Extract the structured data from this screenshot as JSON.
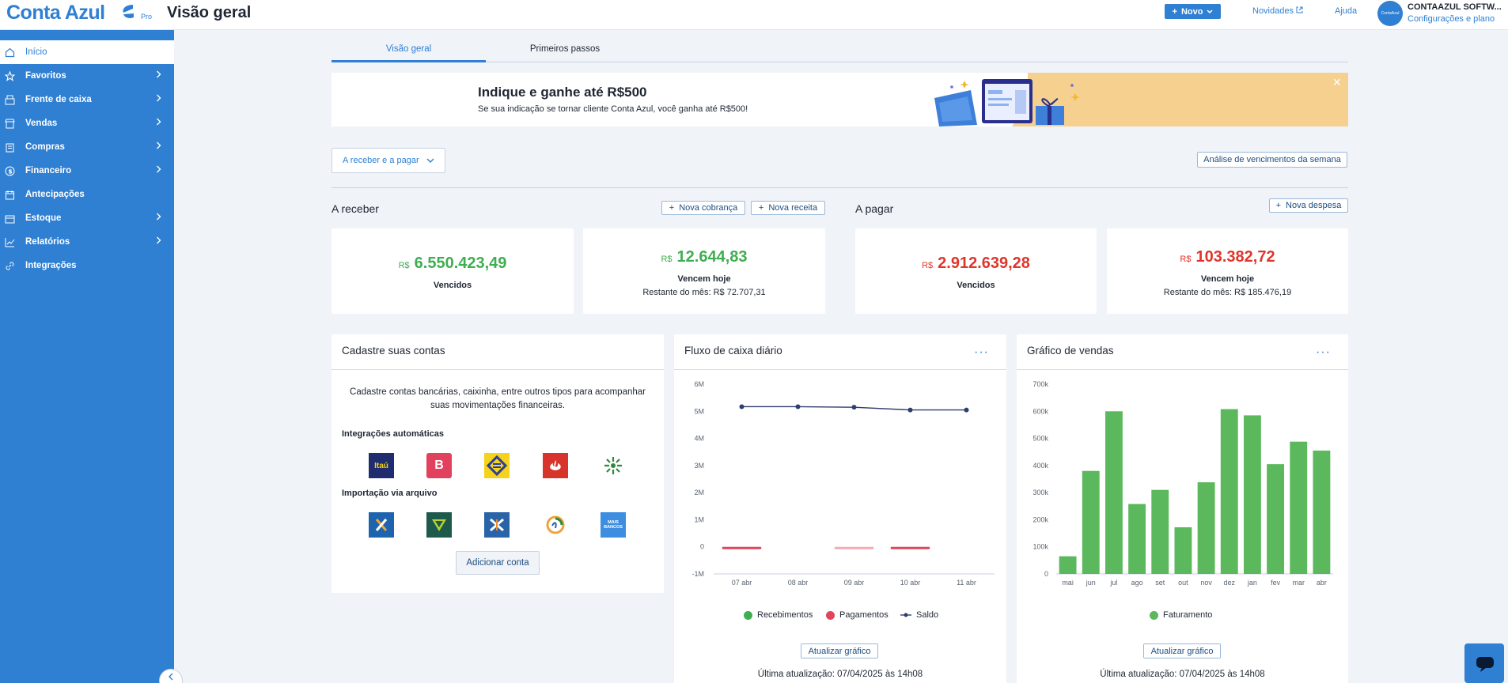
{
  "header": {
    "logo_text": "Conta Azul",
    "logo_badge": "Pro",
    "page_title": "Visão geral",
    "new_button": "Novo",
    "news_link": "Novidades",
    "help_link": "Ajuda",
    "avatar_text": "ContaAzul",
    "company_name": "CONTAAZUL SOFTW...",
    "company_sub": "Configurações e plano"
  },
  "sidebar": {
    "items": [
      {
        "label": "Início",
        "icon": "home-icon"
      },
      {
        "label": "Favoritos",
        "icon": "star-icon"
      },
      {
        "label": "Frente de caixa",
        "icon": "cash-register-icon"
      },
      {
        "label": "Vendas",
        "icon": "store-icon"
      },
      {
        "label": "Compras",
        "icon": "clipboard-icon"
      },
      {
        "label": "Financeiro",
        "icon": "dollar-icon"
      },
      {
        "label": "Antecipações",
        "icon": "calendar-money-icon"
      },
      {
        "label": "Estoque",
        "icon": "box-icon"
      },
      {
        "label": "Relatórios",
        "icon": "chart-icon"
      },
      {
        "label": "Integrações",
        "icon": "link-icon"
      }
    ]
  },
  "tabs": [
    {
      "label": "Visão geral"
    },
    {
      "label": "Primeiros passos"
    }
  ],
  "banner": {
    "title": "Indique e ganhe até R$500",
    "text": "Se sua indicação se tornar cliente Conta Azul, você ganha até R$500!"
  },
  "filter": {
    "dropdown_label": "A receber e a pagar",
    "analysis_button": "Análise de vencimentos da semana"
  },
  "receivable": {
    "title": "A receber",
    "new_charge": "Nova cobrança",
    "new_income": "Nova receita",
    "overdue": {
      "currency": "R$",
      "value": "6.550.423,49",
      "label": "Vencidos"
    },
    "today": {
      "currency": "R$",
      "value": "12.644,83",
      "label": "Vencem hoje",
      "rest": "Restante do mês: R$ 72.707,31"
    }
  },
  "payable": {
    "title": "A pagar",
    "new_expense": "Nova despesa",
    "overdue": {
      "currency": "R$",
      "value": "2.912.639,28",
      "label": "Vencidos"
    },
    "today": {
      "currency": "R$",
      "value": "103.382,72",
      "label": "Vencem hoje",
      "rest": "Restante do mês: R$ 185.476,19"
    }
  },
  "accounts_panel": {
    "title": "Cadastre suas contas",
    "text": "Cadastre contas bancárias, caixinha, entre outros tipos para acompanhar suas movimentações financeiras.",
    "auto_heading": "Integrações automáticas",
    "auto_banks": [
      {
        "name": "Itaú",
        "color": "#1f2d6e"
      },
      {
        "name": "B",
        "color": "#e2415e"
      },
      {
        "name": "Banco do Brasil",
        "color": "#f5d21b"
      },
      {
        "name": "Santander",
        "color": "#d7352b"
      },
      {
        "name": "Sicredi",
        "color": "#ffffff"
      }
    ],
    "import_heading": "Importação via arquivo",
    "import_banks": [
      {
        "name": "X",
        "color": "#1d63ad"
      },
      {
        "name": "Sicoob",
        "color": "#1d5a4c"
      },
      {
        "name": "Caixa",
        "color": "#2a64a8"
      },
      {
        "name": "Cresol",
        "color": "#ffffff"
      },
      {
        "name": "MAIS BANCOS",
        "color": "#3d8ee0"
      }
    ],
    "add_button": "Adicionar conta"
  },
  "cashflow_panel": {
    "title": "Fluxo de caixa diário",
    "more_icon": "more-icon",
    "legend": [
      {
        "label": "Recebimentos",
        "color": "#3fae50"
      },
      {
        "label": "Pagamentos",
        "color": "#e0455a"
      },
      {
        "label": "Saldo",
        "color": "#2e3f6e"
      }
    ],
    "update_button": "Atualizar gráfico",
    "last_update": "Última atualização: 07/04/2025 às 14h08"
  },
  "sales_panel": {
    "title": "Gráfico de vendas",
    "more_icon": "more-icon",
    "legend": [
      {
        "label": "Faturamento",
        "color": "#5cb85c"
      }
    ],
    "update_button": "Atualizar gráfico",
    "last_update": "Última atualização: 07/04/2025 às 14h08"
  },
  "chart_data": [
    {
      "type": "line",
      "title": "Fluxo de caixa diário",
      "categories": [
        "07 abr",
        "08 abr",
        "09 abr",
        "10 abr",
        "11 abr"
      ],
      "yticks": [
        "6M",
        "5M",
        "4M",
        "3M",
        "2M",
        "1M",
        "0",
        "-1M"
      ],
      "ylim": [
        -1000000,
        6000000
      ],
      "series": [
        {
          "name": "Saldo",
          "values": [
            5170000,
            5170000,
            5150000,
            5050000,
            5050000
          ]
        },
        {
          "name": "Recebimentos",
          "values": [
            0,
            0,
            0,
            0,
            0
          ]
        },
        {
          "name": "Pagamentos",
          "values": [
            -40000,
            0,
            -10000,
            -40000,
            0
          ]
        }
      ]
    },
    {
      "type": "bar",
      "title": "Gráfico de vendas",
      "categories": [
        "mai",
        "jun",
        "jul",
        "ago",
        "set",
        "out",
        "nov",
        "dez",
        "jan",
        "fev",
        "mar",
        "abr"
      ],
      "yticks": [
        "700k",
        "600k",
        "500k",
        "400k",
        "300k",
        "200k",
        "100k",
        "0"
      ],
      "ylim": [
        0,
        700000
      ],
      "series": [
        {
          "name": "Faturamento",
          "values": [
            65000,
            380000,
            600000,
            258000,
            310000,
            172000,
            338000,
            608000,
            585000,
            405000,
            488000,
            455000
          ]
        }
      ]
    }
  ]
}
